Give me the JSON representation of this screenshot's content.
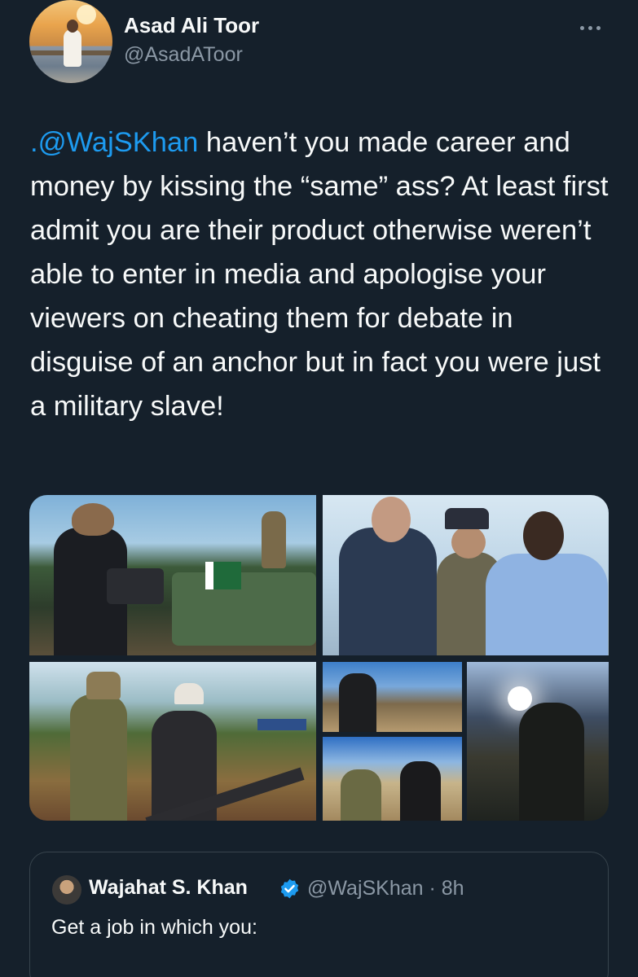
{
  "author": {
    "display_name": "Asad Ali Toor",
    "handle": "@AsadAToor",
    "avatar_icon": "profile-photo"
  },
  "more_icon": "ellipsis-icon",
  "tweet": {
    "mention": ".@WajSKhan",
    "text": " haven’t you made career and money by kissing the “same” ass? At least first admit you are their product otherwise weren’t able to enter in media and apologise your viewers on cheating them for debate in disguise of an anchor but in fact you were just a military slave!"
  },
  "media": {
    "photo_count": 6
  },
  "quoted_tweet": {
    "display_name": "Wajahat S. Khan",
    "verified_icon": "verified-badge-icon",
    "handle_time": "@WajSKhan · 8h",
    "text": "Get a job in which you:"
  },
  "colors": {
    "background": "#15202b",
    "text": "#f7f9f9",
    "secondary_text": "#8b98a5",
    "link": "#1d9bf0",
    "border": "#38444d"
  }
}
